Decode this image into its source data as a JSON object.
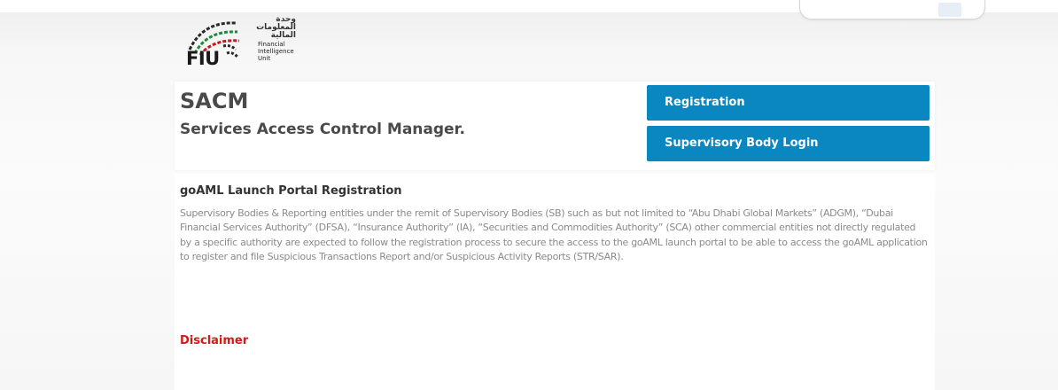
{
  "logo": {
    "abbrev": "FIU",
    "arabic_lines": [
      "وحدة",
      "المعلومات",
      "المالية"
    ],
    "english_lines": [
      "Financial",
      "Intelligence",
      "Unit"
    ]
  },
  "header": {
    "title": "SACM",
    "subtitle": "Services Access Control Manager."
  },
  "actions": {
    "registration_label": "Registration",
    "supervisory_login_label": "Supervisory Body Login"
  },
  "content": {
    "section_title": "goAML Launch Portal Registration",
    "section_body": "Supervisory Bodies & Reporting entities under the remit of Supervisory Bodies (SB) such as but not limited to “Abu Dhabi Global Markets” (ADGM), “Dubai Financial Services Authority” (DFSA), “Insurance Authority” (IA), “Securities and Commodities Authority” (SCA) other commercial entities not directly regulated by a specific authority are expected to follow the registration process to secure the access to the goAML launch portal to be able to access the goAML application to register and file Suspicious Transactions Report and/or Suspicious Activity Reports (STR/SAR).",
    "disclaimer_label": "Disclaimer"
  },
  "colors": {
    "primary_button": "#0a86c0",
    "disclaimer": "#d11a1a",
    "heading": "#4a4a4a",
    "body_text": "#8a8a8a"
  }
}
